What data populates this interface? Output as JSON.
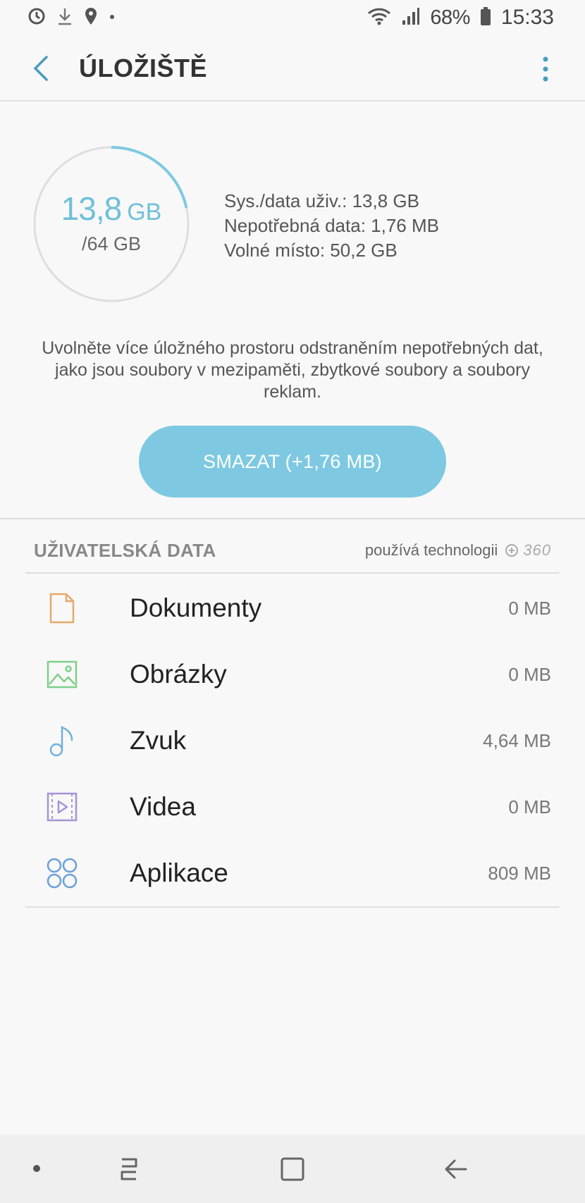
{
  "status_bar": {
    "battery": "68%",
    "time": "15:33",
    "left_icons": [
      "alarm-icon",
      "download-icon",
      "location-icon",
      "dot-icon"
    ],
    "right_icons": [
      "wifi-icon",
      "signal-icon",
      "battery-icon"
    ]
  },
  "app_bar": {
    "title": "ÚLOŽIŠTĚ",
    "accent": "#4a9bbd"
  },
  "storage": {
    "used_value": "13,8",
    "used_unit": "GB",
    "total": "/64 GB",
    "used_fraction": 0.216,
    "ring_color": "#7ec9e1",
    "sys_user_data": "Sys./data uživ.: 13,8 GB",
    "junk_data": "Nepotřebná data: 1,76 MB",
    "free_space": "Volné místo: 50,2 GB",
    "description": "Uvolněte více úložného prostoru odstraněním nepotřebných dat, jako jsou soubory v mezipaměti, zbytkové soubory a soubory reklam.",
    "clear_button": "SMAZAT (+1,76 MB)"
  },
  "user_data": {
    "title": "UŽIVATELSKÁ DATA",
    "powered_by": "používá technologii",
    "powered_logo": "360",
    "items": [
      {
        "label": "Dokumenty",
        "value": "0 MB",
        "icon": "document-icon",
        "color": "#e6a869"
      },
      {
        "label": "Obrázky",
        "value": "0 MB",
        "icon": "image-icon",
        "color": "#7fcf8a"
      },
      {
        "label": "Zvuk",
        "value": "4,64 MB",
        "icon": "music-note-icon",
        "color": "#6fb1dc"
      },
      {
        "label": "Videa",
        "value": "0 MB",
        "icon": "video-icon",
        "color": "#a593d6"
      },
      {
        "label": "Aplikace",
        "value": "809 MB",
        "icon": "apps-icon",
        "color": "#6a9fd6"
      }
    ]
  },
  "nav_bar": {
    "icons": [
      "dot-icon",
      "recent-apps-icon",
      "home-icon",
      "back-icon"
    ]
  }
}
